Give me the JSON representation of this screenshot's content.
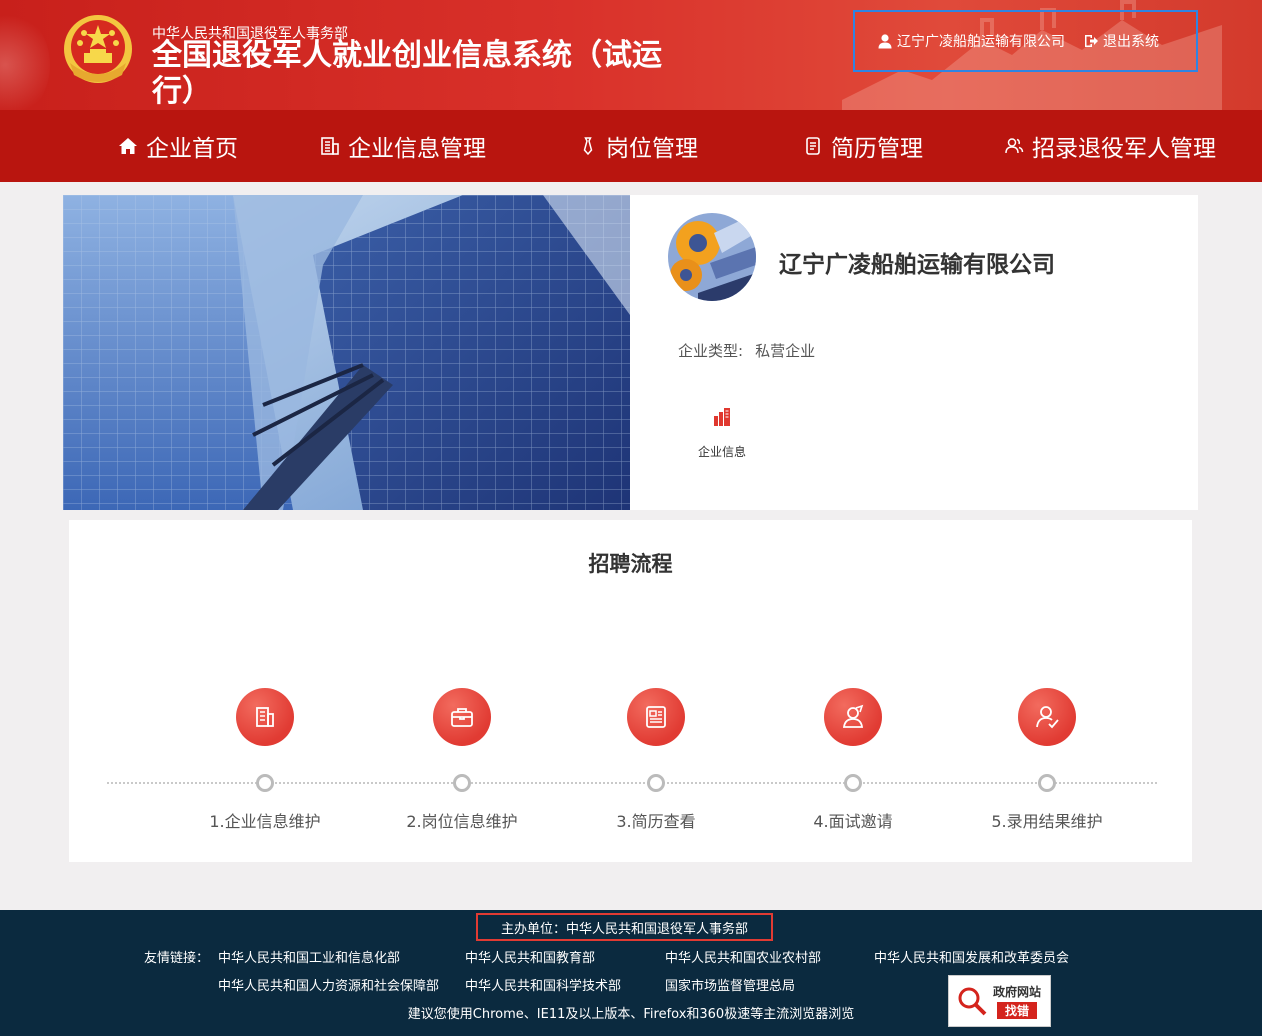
{
  "header": {
    "subtitle": "中华人民共和国退役军人事务部",
    "title": "全国退役军人就业创业信息系统（试运行）",
    "user": "辽宁广凌船舶运输有限公司",
    "logout": "退出系统"
  },
  "nav": [
    {
      "label": "企业首页",
      "icon": "home-icon"
    },
    {
      "label": "企业信息管理",
      "icon": "building-icon"
    },
    {
      "label": "岗位管理",
      "icon": "tie-icon"
    },
    {
      "label": "简历管理",
      "icon": "document-icon"
    },
    {
      "label": "招录退役军人管理",
      "icon": "users-icon"
    }
  ],
  "company": {
    "name": "辽宁广凌船舶运输有限公司",
    "type_label": "企业类型:",
    "type_value": "私营企业",
    "info_link": "企业信息"
  },
  "process": {
    "title": "招聘流程",
    "steps": [
      {
        "label": "1.企业信息维护",
        "icon": "building-icon"
      },
      {
        "label": "2.岗位信息维护",
        "icon": "briefcase-icon"
      },
      {
        "label": "3.简历查看",
        "icon": "resume-icon"
      },
      {
        "label": "4.面试邀请",
        "icon": "interview-icon"
      },
      {
        "label": "5.录用结果维护",
        "icon": "user-check-icon"
      }
    ]
  },
  "footer": {
    "sponsor": "主办单位：中华人民共和国退役军人事务部",
    "links_label": "友情链接：",
    "links": [
      "中华人民共和国工业和信息化部",
      "中华人民共和国教育部",
      "中华人民共和国农业农村部",
      "中华人民共和国发展和改革委员会",
      "中华人民共和国人力资源和社会保障部",
      "中华人民共和国科学技术部",
      "国家市场监督管理总局"
    ],
    "browser_note": "建议您使用Chrome、IE11及以上版本、Firefox和360极速等主流浏览器浏览",
    "jiucuo_line1": "政府网站",
    "jiucuo_line2": "找错"
  },
  "colors": {
    "primary_red": "#c8201b",
    "nav_red": "#b9150f",
    "footer_navy": "#0b2a3f",
    "highlight_blue": "#2f84e3"
  }
}
